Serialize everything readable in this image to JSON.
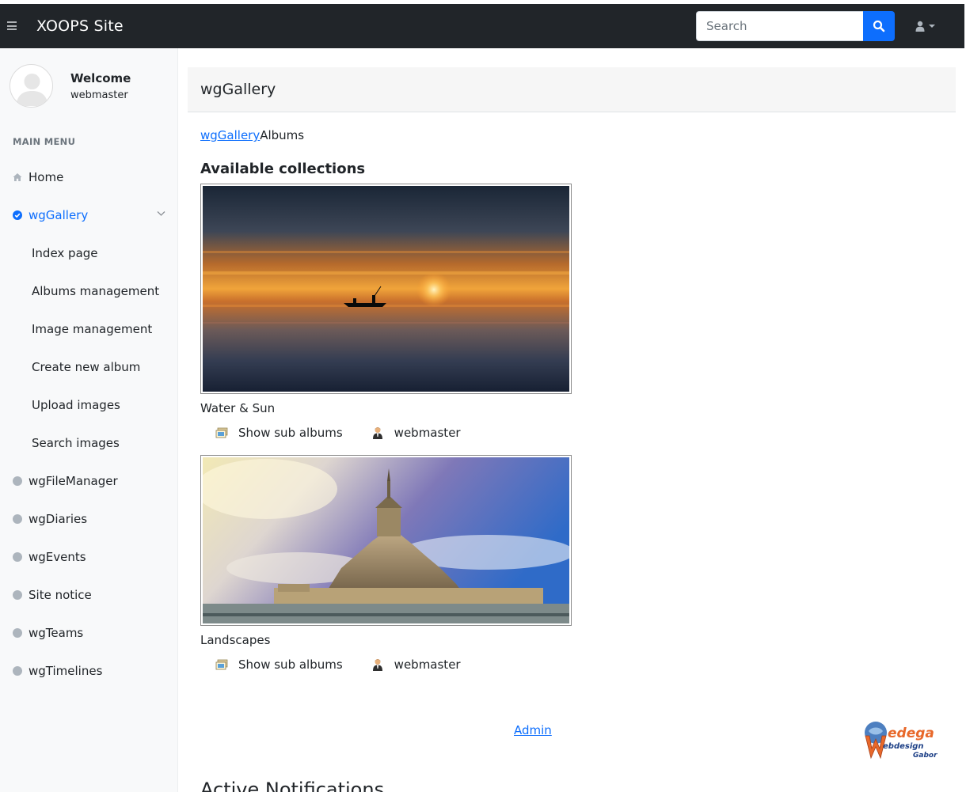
{
  "header": {
    "brand": "XOOPS Site",
    "search_placeholder": "Search"
  },
  "sidebar": {
    "welcome": "Welcome",
    "username": "webmaster",
    "menu_heading": "MAIN MENU",
    "items": [
      {
        "label": "Home",
        "icon": "home-icon"
      },
      {
        "label": "wgGallery",
        "icon": "check-circle-icon",
        "active": true
      },
      {
        "label": "wgFileManager",
        "icon": "dot-icon"
      },
      {
        "label": "wgDiaries",
        "icon": "dot-icon"
      },
      {
        "label": "wgEvents",
        "icon": "dot-icon"
      },
      {
        "label": "Site notice",
        "icon": "dot-icon"
      },
      {
        "label": "wgTeams",
        "icon": "dot-icon"
      },
      {
        "label": "wgTimelines",
        "icon": "dot-icon"
      }
    ],
    "subitems": [
      "Index page",
      "Albums management",
      "Image management",
      "Create new album",
      "Upload images",
      "Search images"
    ]
  },
  "main": {
    "page_title": "wgGallery",
    "breadcrumb_link": "wgGallery",
    "breadcrumb_current": "Albums",
    "section_title": "Available collections",
    "albums": [
      {
        "name": "Water & Sun",
        "subalbums_label": "Show sub albums",
        "owner": "webmaster"
      },
      {
        "name": "Landscapes",
        "subalbums_label": "Show sub albums",
        "owner": "webmaster"
      }
    ],
    "admin_link": "Admin",
    "notifications_title": "Active Notifications",
    "logo_text_1": "edega",
    "logo_text_2": "ebdesign",
    "logo_text_3": "Gabor"
  },
  "colors": {
    "navbar": "#212529",
    "accent": "#0d6efd",
    "sidebar_bg": "#f8f9fa"
  }
}
